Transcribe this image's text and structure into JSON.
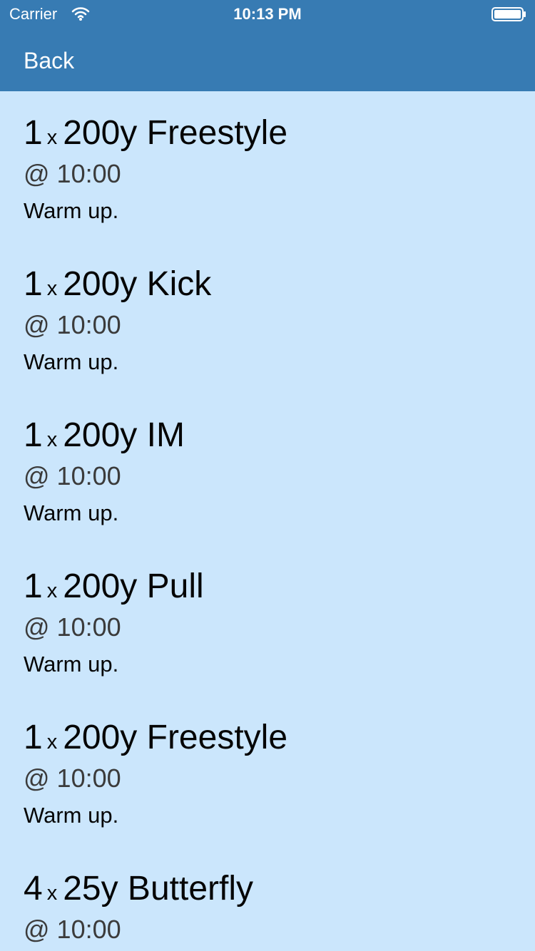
{
  "status_bar": {
    "carrier": "Carrier",
    "time": "10:13 PM",
    "icons": {
      "signal": "wifi-icon",
      "battery": "battery-icon"
    }
  },
  "navigation": {
    "back_label": "Back",
    "color": "#377bb3"
  },
  "sets": [
    {
      "reps": "1",
      "times_symbol": "x",
      "description": "200y Freestyle",
      "interval": "@ 10:00",
      "note": "Warm up."
    },
    {
      "reps": "1",
      "times_symbol": "x",
      "description": "200y Kick",
      "interval": "@ 10:00",
      "note": "Warm up."
    },
    {
      "reps": "1",
      "times_symbol": "x",
      "description": "200y IM",
      "interval": "@ 10:00",
      "note": "Warm up."
    },
    {
      "reps": "1",
      "times_symbol": "x",
      "description": "200y Pull",
      "interval": "@ 10:00",
      "note": "Warm up."
    },
    {
      "reps": "1",
      "times_symbol": "x",
      "description": "200y Freestyle",
      "interval": "@ 10:00",
      "note": "Warm up."
    },
    {
      "reps": "4",
      "times_symbol": "x",
      "description": "25y Butterfly",
      "interval": "@ 10:00",
      "note": ""
    }
  ],
  "colors": {
    "background": "#cbe6fc",
    "header": "#377bb3",
    "primary_text": "#050505",
    "secondary_text": "#3b3b3b"
  }
}
